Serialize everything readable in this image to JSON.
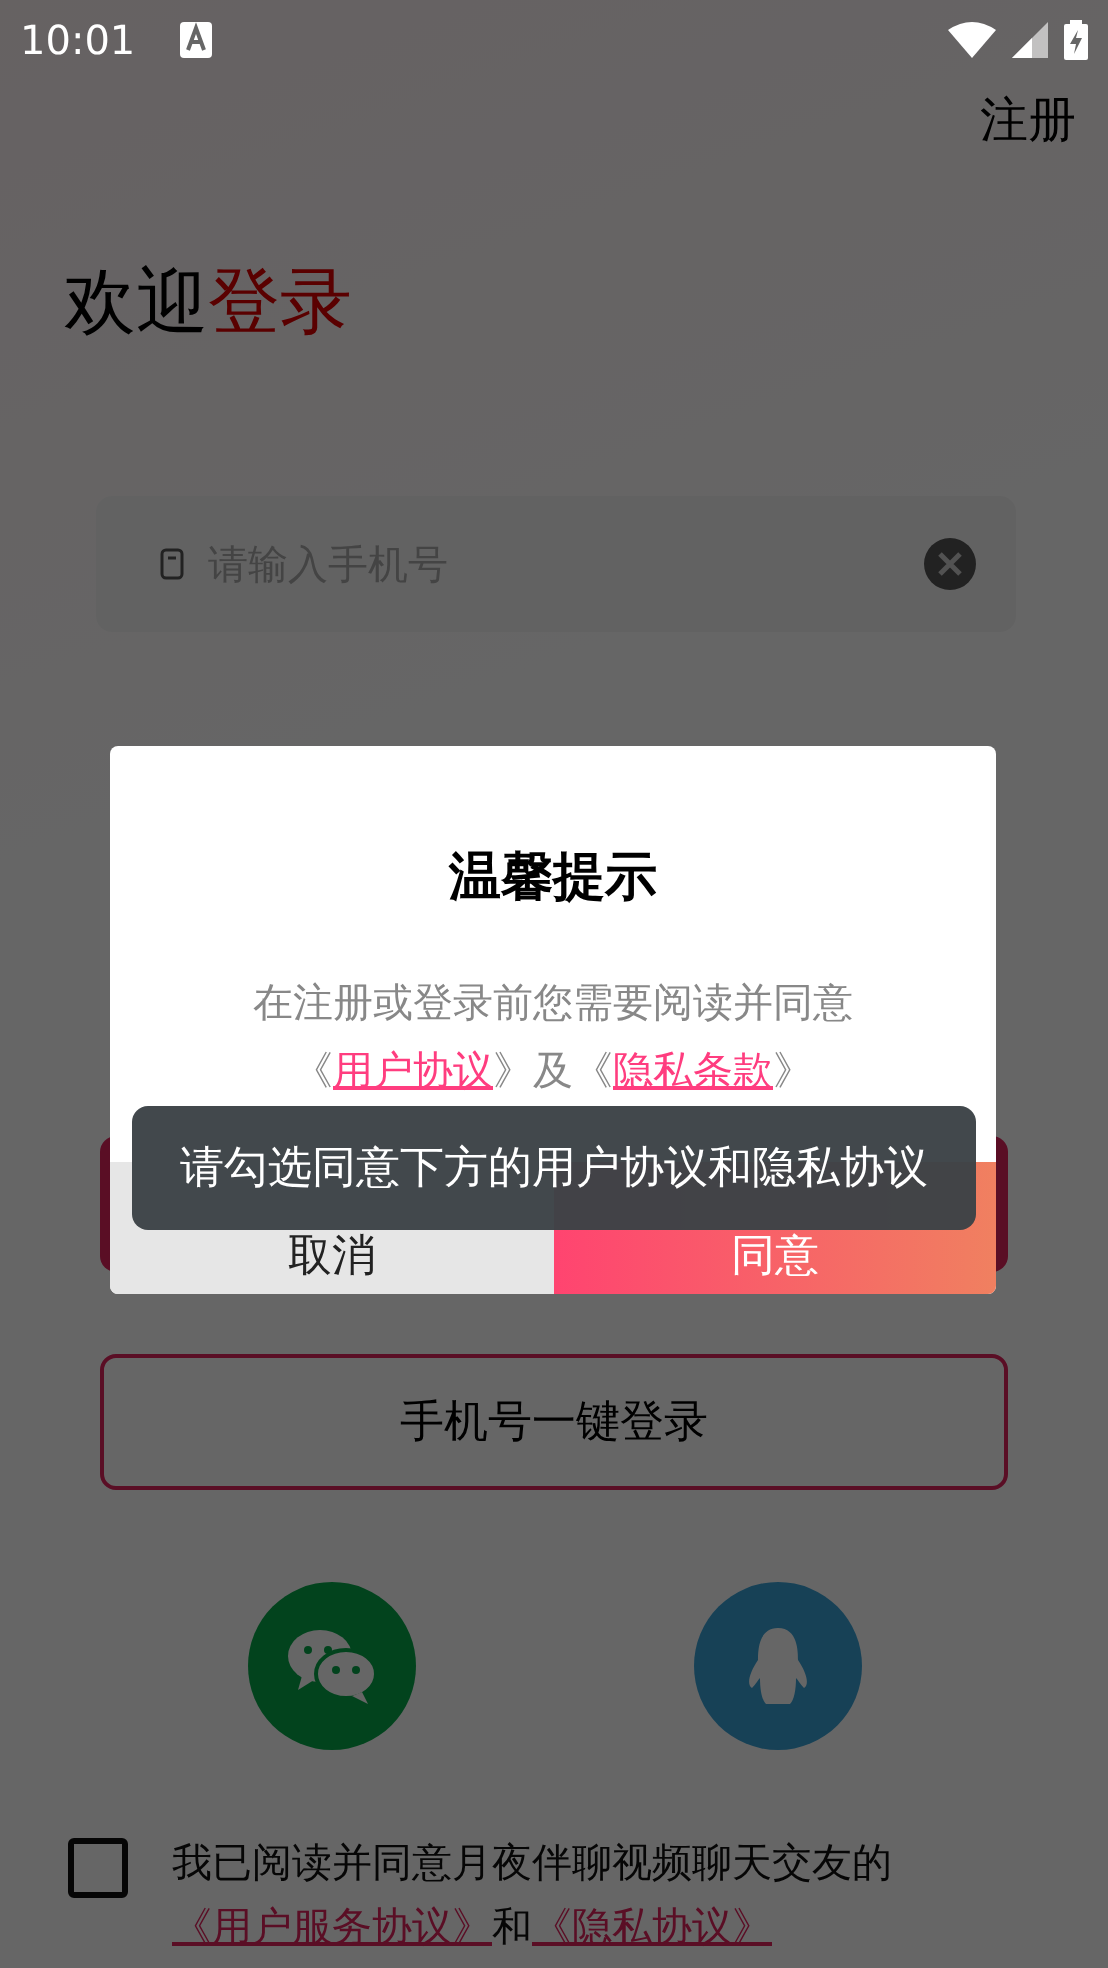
{
  "status_bar": {
    "time": "10:01"
  },
  "register_link": "注册",
  "welcome": {
    "text": "欢迎",
    "highlight": "登录"
  },
  "phone_field": {
    "placeholder": "请输入手机号"
  },
  "one_key_login": "手机号一键登录",
  "social_logins": [
    {
      "kind": "wechat"
    },
    {
      "kind": "qq"
    }
  ],
  "agreement": {
    "checked": false,
    "text": "我已阅读并同意月夜伴聊视频聊天交友的",
    "links": [
      "《用户服务协议》",
      "《隐私协议》"
    ],
    "joiner": "和"
  },
  "dialog": {
    "title": "温馨提示",
    "message": [
      {
        "kind": "text",
        "text": "在注册或登录前您需要阅读并同意《"
      },
      {
        "kind": "link",
        "text": "用户协议"
      },
      {
        "kind": "text",
        "text": "》及《"
      },
      {
        "kind": "link",
        "text": "隐私条款"
      },
      {
        "kind": "text",
        "text": "》"
      }
    ],
    "buttons": [
      {
        "kind": "cancel",
        "label": "取消"
      },
      {
        "kind": "confirm",
        "label": "同意"
      }
    ]
  },
  "toast": "请勾选同意下方的用户协议和隐私协议"
}
